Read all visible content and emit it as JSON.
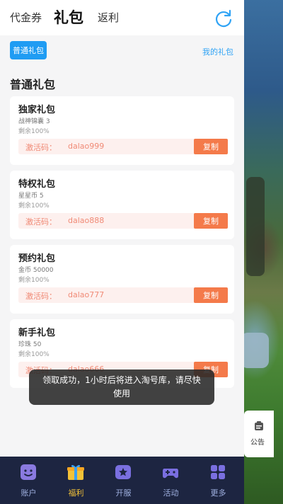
{
  "header": {
    "tabs": [
      {
        "label": "代金券"
      },
      {
        "label": "礼包"
      },
      {
        "label": "返利"
      }
    ]
  },
  "filter": {
    "active_chip": "普通礼包",
    "my_gifts_link": "我的礼包"
  },
  "section": {
    "title": "普通礼包"
  },
  "gifts": [
    {
      "name": "独家礼包",
      "item": "战神锦囊 3",
      "remaining": "剩余100%",
      "code_label": "激活码：",
      "code": "dalao999",
      "copy_label": "复制"
    },
    {
      "name": "特权礼包",
      "item": "星星币 5",
      "remaining": "剩余100%",
      "code_label": "激活码：",
      "code": "dalao888",
      "copy_label": "复制"
    },
    {
      "name": "预约礼包",
      "item": "金币 50000",
      "remaining": "剩余100%",
      "code_label": "激活码：",
      "code": "dalao777",
      "copy_label": "复制"
    },
    {
      "name": "新手礼包",
      "item": "珍珠 50",
      "remaining": "剩余100%",
      "code_label": "激活码：",
      "code": "dalao666",
      "copy_label": "复制"
    }
  ],
  "toast": {
    "line1": "领取成功，1小时后将进入淘号库，请尽快",
    "line2": "使用"
  },
  "notice": {
    "label": "公告",
    "icon": "announcement-icon"
  },
  "bottom_nav": [
    {
      "label": "账户",
      "icon": "account-icon"
    },
    {
      "label": "福利",
      "icon": "gift-box-icon"
    },
    {
      "label": "开服",
      "icon": "server-icon"
    },
    {
      "label": "活动",
      "icon": "gamepad-icon"
    },
    {
      "label": "更多",
      "icon": "grid-icon"
    }
  ],
  "colors": {
    "accent_blue": "#1f9cf3",
    "copy_orange": "#f47a4a",
    "code_text": "#f08a76",
    "nav_bg": "#1d2541",
    "nav_active": "#f3c238"
  }
}
